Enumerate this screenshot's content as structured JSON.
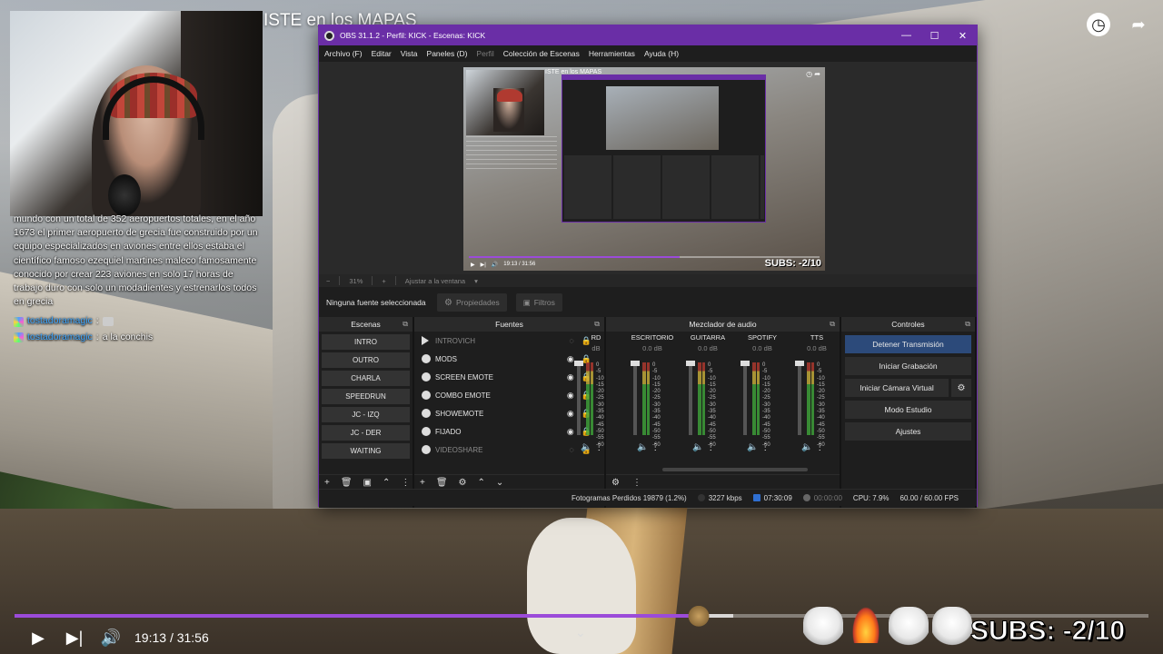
{
  "video": {
    "title": "ISTE en los MAPAS",
    "current_time": "19:13",
    "duration": "31:56",
    "time_separator": "/",
    "progress": 0.602,
    "subs_counter": "SUBS: -2/10"
  },
  "chat": {
    "message_text": "mundo con un total de 352 aeropuertos totales, en el año 1673 el primer aeropuerto de grecia fue construido por un equipo especializados en aviones entre ellos estaba el científico famoso ezequiel martines maleco famosamente conocido por crear 223 aviones en solo 17 horas de trabajo duro con solo un modadientes y estrenarlos todos en grecia",
    "lines": [
      {
        "user": "tostadoramagic",
        "separator": ":",
        "text": ""
      },
      {
        "user": "tostadoramagic",
        "separator": ":",
        "text": "a la conchis"
      }
    ],
    "user_color": "#3fa7ff"
  },
  "obs": {
    "title": "OBS 31.1.2 - Perfil: KICK - Escenas: KICK",
    "window_buttons": {
      "minimize": "—",
      "maximize": "☐",
      "close": "✕"
    },
    "menu": [
      "Archivo (F)",
      "Editar",
      "Vista",
      "Paneles (D)",
      "Perfil",
      "Colección de Escenas",
      "Herramientas",
      "Ayuda (H)"
    ],
    "preview": {
      "inner_title": "ISTE en los MAPAS",
      "inner_time": "19:13 / 31:56",
      "inner_subs": "SUBS: -2/10"
    },
    "zoom": {
      "minus": "−",
      "value": "31%",
      "plus": "+",
      "mode": "Ajustar a la ventana"
    },
    "source_toolbar": {
      "no_source": "Ninguna fuente seleccionada",
      "properties": "Propiedades",
      "filters": "Filtros"
    },
    "docks": {
      "scenes": {
        "title": "Escenas",
        "items": [
          "INTRO",
          "OUTRO",
          "CHARLA",
          "SPEEDRUN",
          "JC - IZQ",
          "JC - DER",
          "WAITING"
        ]
      },
      "sources": {
        "title": "Fuentes",
        "items": [
          {
            "name": "INTROVICH",
            "visible": false
          },
          {
            "name": "MODS",
            "visible": true
          },
          {
            "name": "SCREEN EMOTE",
            "visible": true
          },
          {
            "name": "COMBO EMOTE",
            "visible": true
          },
          {
            "name": "SHOWEMOTE",
            "visible": true
          },
          {
            "name": "FIJADO",
            "visible": true
          },
          {
            "name": "VIDEOSHARE",
            "visible": false
          }
        ]
      },
      "mixer": {
        "title": "Mezclador de audio",
        "channels": [
          {
            "name": "RD",
            "db": "dB"
          },
          {
            "name": "ESCRITORIO",
            "db": "0.0 dB"
          },
          {
            "name": "GUITARRA",
            "db": "0.0 dB"
          },
          {
            "name": "SPOTIFY",
            "db": "0.0 dB"
          },
          {
            "name": "TTS",
            "db": "0.0 dB"
          }
        ],
        "scale": [
          "0",
          "-5",
          "-10",
          "-15",
          "-20",
          "-25",
          "-30",
          "-35",
          "-40",
          "-45",
          "-50",
          "-55",
          "-60"
        ]
      },
      "controls": {
        "title": "Controles",
        "stop_stream": "Detener Transmisión",
        "start_recording": "Iniciar Grabación",
        "start_virtual_cam": "Iniciar Cámara Virtual",
        "studio_mode": "Modo Estudio",
        "settings": "Ajustes"
      }
    },
    "status": {
      "dropped_frames": "Fotogramas Perdidos 19879 (1.2%)",
      "bitrate": "3227 kbps",
      "stream_time": "07:30:09",
      "record_time": "00:00:00",
      "cpu": "CPU: 7.9%",
      "fps": "60.00 / 60.00 FPS"
    }
  },
  "colors": {
    "obs_accent": "#6a2ea6",
    "progress": "#9b4bd9",
    "stop_button": "#2c4a7a"
  }
}
